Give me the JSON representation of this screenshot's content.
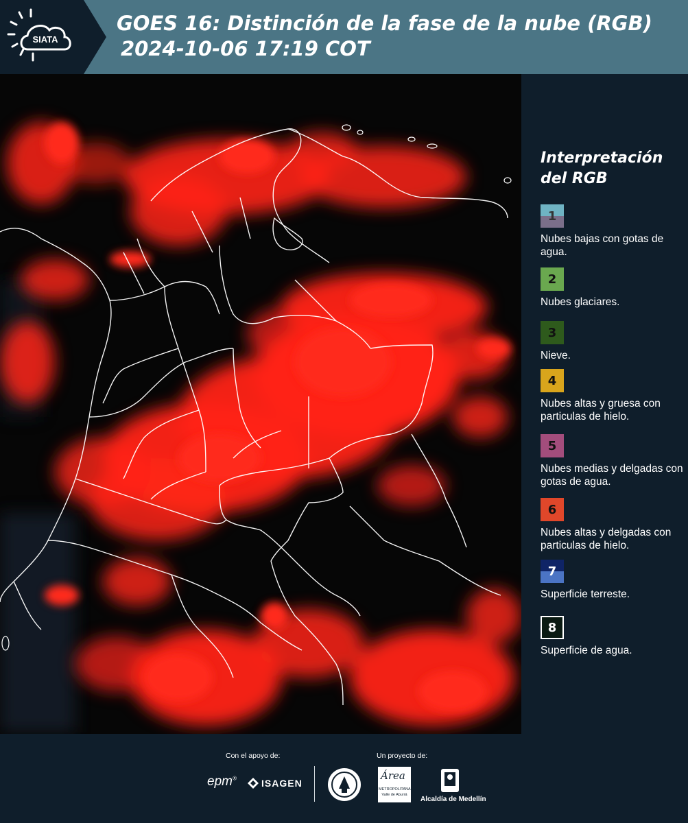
{
  "header": {
    "logo_text": "SIATA",
    "title_line1": "GOES 16: Distinción de la fase de la nube (RGB)",
    "title_line2": "2024-10-06 17:19 COT"
  },
  "legend": {
    "title_line1": "Interpretación",
    "title_line2": "del RGB",
    "items": [
      {
        "number": "1",
        "label": "Nubes bajas con gotas de agua.",
        "color_top": "#6fb3c3",
        "color_bottom": "#7b6f8a"
      },
      {
        "number": "2",
        "label": "Nubes glaciares.",
        "color_top": "#6aa84f",
        "color_bottom": "#6aa84f"
      },
      {
        "number": "3",
        "label": "Nieve.",
        "color_top": "#2e5a1c",
        "color_bottom": "#2e5a1c"
      },
      {
        "number": "4",
        "label": "Nubes altas y gruesa con particulas de hielo.",
        "color_top": "#d9a51c",
        "color_bottom": "#d9a51c"
      },
      {
        "number": "5",
        "label": "Nubes medias y delgadas con gotas de agua.",
        "color_top": "#a34d7c",
        "color_bottom": "#a34d7c"
      },
      {
        "number": "6",
        "label": "Nubes altas y delgadas con particulas de hielo.",
        "color_top": "#e0472a",
        "color_bottom": "#e0472a"
      },
      {
        "number": "7",
        "label": "Superficie terreste.",
        "color_top": "#0f2466",
        "color_bottom": "#4b74c4"
      },
      {
        "number": "8",
        "label": "Superficie de agua.",
        "color_top": "#0a1a12",
        "color_bottom": "#0a1a12"
      }
    ]
  },
  "footer": {
    "support_label": "Con el apoyo de:",
    "project_label": "Un proyecto de:",
    "epm_text": "epm",
    "isagen_text": "ISAGEN",
    "area_text": "Área",
    "area_sub1": "METROPOLITANA",
    "area_sub2": "Valle de Aburrá",
    "alcaldia_text": "Alcaldía de Medellín"
  },
  "colors": {
    "header_bg": "#4b7585",
    "panel_bg": "#0f1e2b",
    "cloud_red": "#ff2418"
  }
}
